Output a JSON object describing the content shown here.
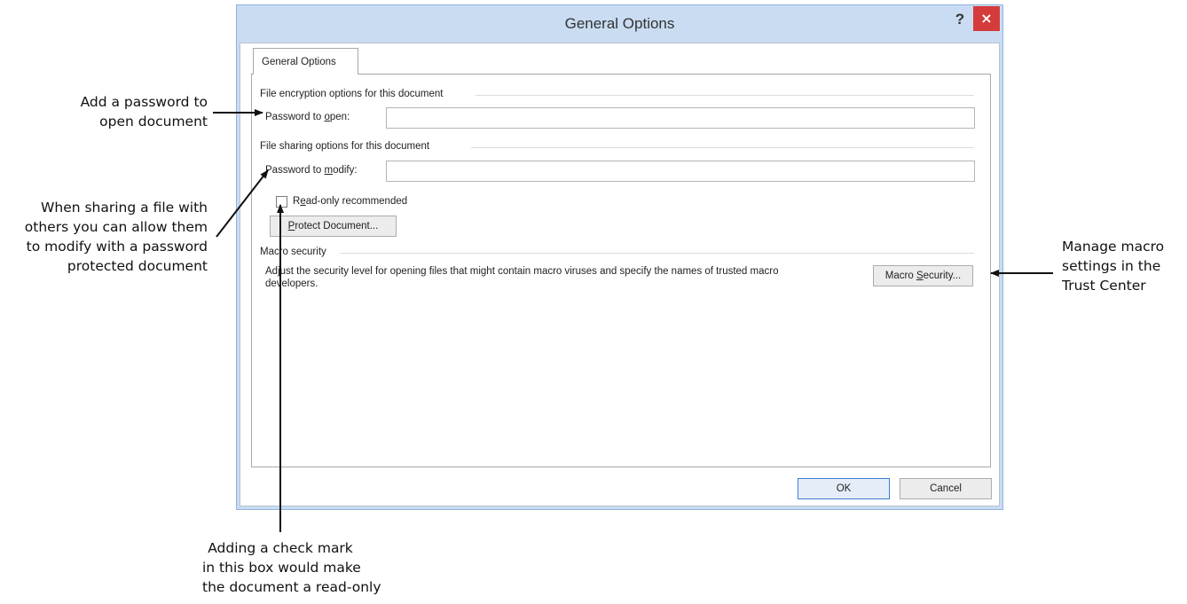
{
  "dialog": {
    "title": "General Options",
    "help_label": "?",
    "close_label": "×",
    "tab_label": "General Options",
    "encryption_section": "File encryption options for this document",
    "password_open": {
      "pre": "Password to ",
      "accel": "o",
      "post": "pen:",
      "value": ""
    },
    "sharing_section": "File sharing options for this document",
    "password_modify": {
      "pre": "Password to ",
      "accel": "m",
      "post": "odify:",
      "value": ""
    },
    "readonly": {
      "pre": "R",
      "accel": "e",
      "post": "ad-only recommended",
      "checked": false
    },
    "protect_button": {
      "pre": "",
      "accel": "P",
      "post": "rotect Document..."
    },
    "macro_section": "Macro security",
    "macro_description_line1": "Adjust the security level for opening files that might contain macro viruses and specify the names of trusted macro",
    "macro_description_line2": "developers.",
    "macro_button": {
      "pre": "Macro ",
      "accel": "S",
      "post": "ecurity..."
    },
    "ok_label": "OK",
    "cancel_label": "Cancel"
  },
  "callouts": {
    "password_open": [
      "Add a password to",
      "open document"
    ],
    "sharing": [
      "When sharing a file with",
      "others you can allow them",
      "to modify with a password",
      "protected document"
    ],
    "readonly": [
      "Adding a check mark",
      "in this box would make",
      "the document a read-only"
    ],
    "macro": [
      "Manage macro",
      "settings in the",
      "Trust Center"
    ]
  },
  "colors": {
    "frame": "#c9dcf2",
    "close_button": "#d53b3b",
    "ok_border": "#3c7fd1"
  }
}
